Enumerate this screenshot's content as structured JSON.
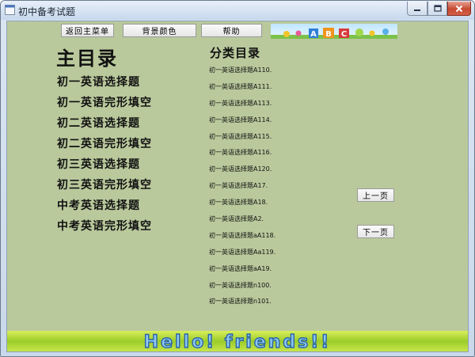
{
  "window": {
    "title": "初中备考试题"
  },
  "toolbar": {
    "back_label": "返回主菜单",
    "bg_color_label": "背景颜色",
    "help_label": "帮助"
  },
  "main_menu": {
    "title": "主目录",
    "items": [
      "初一英语选择题",
      "初一英语完形填空",
      "初二英语选择题",
      "初二英语完形填空",
      "初三英语选择题",
      "初三英语完形填空",
      "中考英语选择题",
      "中考英语完形填空"
    ]
  },
  "category": {
    "title": "分类目录",
    "items": [
      "初一英语选择题A110.",
      "初一英语选择题A111.",
      "初一英语选择题A113.",
      "初一英语选择题A114.",
      "初一英语选择题A115.",
      "初一英语选择题A116.",
      "初一英语选择题A120.",
      "初一英语选择题A17.",
      "初一英语选择题A18.",
      "初一英语选择题A2.",
      "初一英语选择题aA118.",
      "初一英语选择题Aa119.",
      "初一英语选择题aA19.",
      "初一英语选择题n100.",
      "初一英语选择题n101."
    ]
  },
  "pager": {
    "prev_label": "上一页",
    "next_label": "下一页"
  },
  "banners": {
    "top_text": "ABC",
    "bottom_text": "Hello! friends!!"
  },
  "colors": {
    "background": "#b9c99c",
    "banner_green": "#9ccc2a",
    "close_red": "#c64a31"
  },
  "icons": {
    "app": "app-icon",
    "minimize": "minimize-icon",
    "maximize": "maximize-icon",
    "close": "close-icon"
  }
}
